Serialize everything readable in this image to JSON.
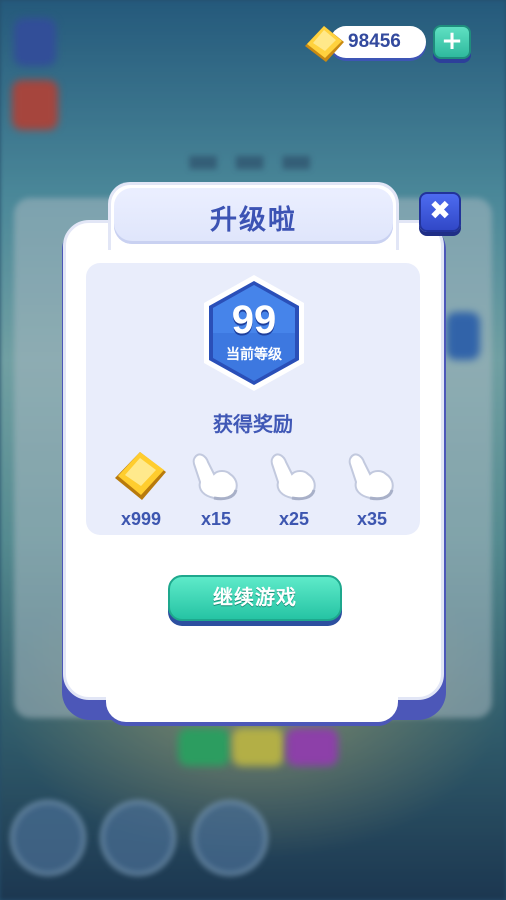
{
  "top_bar": {
    "currency_value": "98456",
    "plus_label": "+",
    "currency_icon": "gold-gem-icon"
  },
  "popup": {
    "title": "升级啦",
    "close_label": "✖",
    "level": {
      "number": "99",
      "label": "当前等级"
    },
    "rewards_title": "获得奖励",
    "rewards": [
      {
        "icon": "gold-gem-icon",
        "quantity": "x999"
      },
      {
        "icon": "pointing-hand-icon",
        "quantity": "x15"
      },
      {
        "icon": "pointing-hand-icon",
        "quantity": "x25"
      },
      {
        "icon": "pointing-hand-icon",
        "quantity": "x35"
      }
    ],
    "continue_label": "继续游戏"
  },
  "colors": {
    "accent_blue": "#3c53b4",
    "button_teal": "#2fc8a6",
    "panel_bg": "#e9edfb"
  }
}
